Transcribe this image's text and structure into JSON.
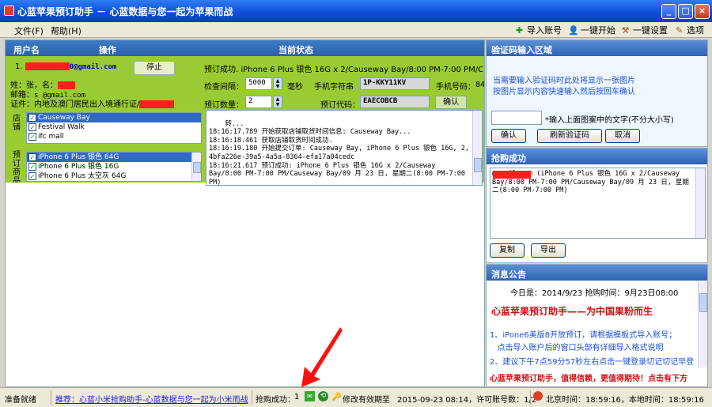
{
  "window": {
    "title": "心蓝苹果预订助手 － 心蓝数据与您一起为苹果而战"
  },
  "menu": {
    "file": "文件(F)",
    "help": "帮助(H)"
  },
  "toolbar": {
    "import": "导入账号",
    "start": "一键开始",
    "settings": "一键设置",
    "options": "选项"
  },
  "table": {
    "col_user": "用户名",
    "col_action": "操作",
    "col_status": "当前状态"
  },
  "account": {
    "index": "1.",
    "email_suffix": "0@gmail.com",
    "stop_label": "停止",
    "name_line": "姓：张，名：",
    "mail_label": "邮箱：",
    "mail_value": "s        @gmail.com",
    "id_line": "证件：内地及澳门居民出入境通行证/"
  },
  "status_line": "预订成功. iPhone 6 Plus 银色 16G x 2/Causeway Bay/8:00 PM-7:00 PM/Causeway",
  "fields": {
    "interval_label": "检查间隔：",
    "interval_value": "5000",
    "ms": "毫秒",
    "phone_code_label": "手机字符串",
    "phone_code_value": "1P-KKY11KV",
    "phone_no_label": "手机号码：",
    "phone_no_value": "84",
    "qty_label": "预订数量：",
    "qty_value": "2",
    "code_label": "预订代码：",
    "code_value": "EAECOBCB",
    "confirm": "确认"
  },
  "stores_label": "店铺",
  "stores": [
    "Causeway Bay",
    "Festival Walk",
    "ifc mall"
  ],
  "products_label": "预订商品",
  "products": [
    "iPhone 6 Plus 银色 64G",
    "iPhone 6 Plus 银色 16G",
    "iPhone 6 Plus 太空灰 64G"
  ],
  "log": "转...\n18:16:17.789 开始获取店铺取货时间信息: Causeway Bay...\n18:16:18.461 获取店铺取货时间成功.\n18:16:19.180 开始提交订单: Causeway Bay, iPhone 6 Plus 银色 16G, 2, 4bfa226e-39a5-4a5a-8364-efa17a04cedc\n18:16:21.617 预订成功: iPhone 6 Plus 银色 16G x 2/Causeway Bay/8:00 PM-7:00 PM/Causeway Bay/09 月 23 日, 星期二(8:00 PM-7:00 PM)",
  "captcha": {
    "header": "验证码输入区域",
    "info1": "当需要输入验证码时此处将显示一张图片",
    "info2": "按图片显示内容快速输入然后按回车确认",
    "hint": "*输入上面图案中的文字(不分大小写)",
    "confirm": "确认",
    "refresh": "刷新验证码",
    "cancel": "取消"
  },
  "success": {
    "header": "抢购成功",
    "text": "       @gmail.com (iPhone 6 Plus 银色 16G x 2/Causeway Bay/8:00 PM-7:00 PM/Causeway Bay/09 月 23 日, 星期二(8:00 PM-7:00 PM)",
    "copy": "复制",
    "export": "导出"
  },
  "notice": {
    "header": "消息公告",
    "date_line": "今日是：2014/9/23   抢购时间：9月23日08:00",
    "title": "心蓝苹果预订助手——为中国果粉而生",
    "item1": "1、iPone6美版8开放预订，请根据模板式导入账号；",
    "item1b": "   点击导入账户后的窗口头部有详细导入格式说明",
    "item2": "2、建议下午7点59分57秒左右点击一键登录切记切记早登",
    "marquee": "心蓝苹果预订助手，值得信赖，更值得期待！点击有下方"
  },
  "status": {
    "ready": "准备就绪",
    "link": "推荐：心蓝小米抢购助手-心蓝数据与您一起为小米而战",
    "count_label": "抢购成功：",
    "count": "1",
    "expire": "修改有效期至",
    "expire_date": "2015-09-23 08:14，许可账号数：1/2",
    "beijing": "北京时间：18:59:16，本地时间：18:59:16"
  }
}
